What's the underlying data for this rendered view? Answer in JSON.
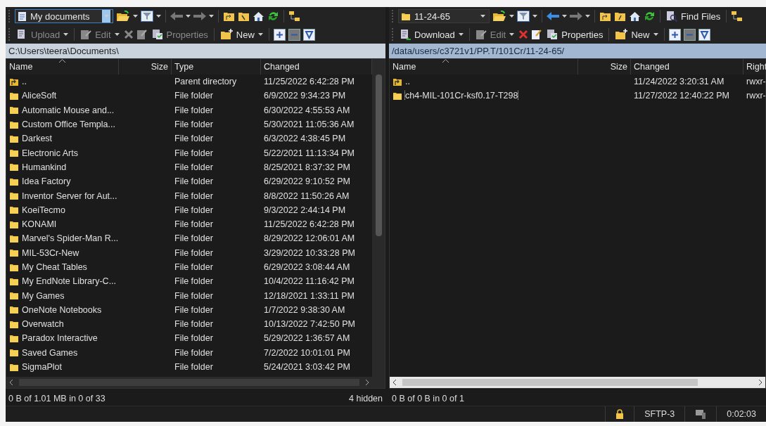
{
  "left_pane": {
    "active": false,
    "location": "My documents",
    "toolbar": [
      {
        "label": "Upload",
        "kind": "upload",
        "disabled": true
      },
      {
        "label": "Edit",
        "kind": "edit",
        "disabled": true
      },
      {
        "label": "Properties",
        "kind": "properties",
        "disabled": true
      },
      {
        "label": "New",
        "kind": "new",
        "disabled": false
      }
    ],
    "path": "C:\\Users\\teera\\Documents\\",
    "columns": [
      "Name",
      "Size",
      "Type",
      "Changed"
    ],
    "rows": [
      {
        "kind": "parent",
        "name": "..",
        "type": "Parent directory",
        "changed": "11/25/2022  6:42:28 PM",
        "focused": false
      },
      {
        "kind": "folder",
        "name": "AliceSoft",
        "type": "File folder",
        "changed": "6/9/2022  9:34:23 PM",
        "focused": false
      },
      {
        "kind": "folder",
        "name": "Automatic Mouse and...",
        "type": "File folder",
        "changed": "6/30/2022  4:55:53 AM",
        "focused": false
      },
      {
        "kind": "folder",
        "name": "Custom Office Templa...",
        "type": "File folder",
        "changed": "5/30/2021  11:05:36 AM",
        "focused": false
      },
      {
        "kind": "folder",
        "name": "Darkest",
        "type": "File folder",
        "changed": "6/3/2022  4:38:45 PM",
        "focused": false
      },
      {
        "kind": "folder",
        "name": "Electronic Arts",
        "type": "File folder",
        "changed": "5/22/2021  11:13:34 PM",
        "focused": false
      },
      {
        "kind": "folder",
        "name": "Humankind",
        "type": "File folder",
        "changed": "8/25/2021  8:37:32 PM",
        "focused": false
      },
      {
        "kind": "folder",
        "name": "Idea Factory",
        "type": "File folder",
        "changed": "6/29/2022  9:10:52 PM",
        "focused": false
      },
      {
        "kind": "folder",
        "name": "Inventor Server for Aut...",
        "type": "File folder",
        "changed": "8/8/2022  11:50:26 AM",
        "focused": false
      },
      {
        "kind": "folder",
        "name": "KoeiTecmo",
        "type": "File folder",
        "changed": "9/3/2022  2:44:14 PM",
        "focused": false
      },
      {
        "kind": "folder",
        "name": "KONAMI",
        "type": "File folder",
        "changed": "11/25/2022  6:42:28 PM",
        "focused": false
      },
      {
        "kind": "folder",
        "name": "Marvel's Spider-Man R...",
        "type": "File folder",
        "changed": "8/29/2022  12:06:01 AM",
        "focused": false
      },
      {
        "kind": "folder",
        "name": "MIL-53Cr-New",
        "type": "File folder",
        "changed": "3/29/2022  10:33:28 PM",
        "focused": false
      },
      {
        "kind": "folder",
        "name": "My Cheat Tables",
        "type": "File folder",
        "changed": "6/29/2022  3:08:44 AM",
        "focused": false
      },
      {
        "kind": "folder",
        "name": "My EndNote Library-C...",
        "type": "File folder",
        "changed": "10/4/2022  11:16:42 PM",
        "focused": false
      },
      {
        "kind": "folder",
        "name": "My Games",
        "type": "File folder",
        "changed": "12/18/2021  1:33:11 PM",
        "focused": false
      },
      {
        "kind": "folder",
        "name": "OneNote Notebooks",
        "type": "File folder",
        "changed": "1/7/2022  9:38:30 AM",
        "focused": false
      },
      {
        "kind": "folder",
        "name": "Overwatch",
        "type": "File folder",
        "changed": "10/13/2022  7:42:50 PM",
        "focused": false
      },
      {
        "kind": "folder",
        "name": "Paradox Interactive",
        "type": "File folder",
        "changed": "5/29/2022  1:36:57 AM",
        "focused": false
      },
      {
        "kind": "folder",
        "name": "Saved Games",
        "type": "File folder",
        "changed": "7/2/2022  10:01:01 PM",
        "focused": false
      },
      {
        "kind": "folder",
        "name": "SigmaPlot",
        "type": "File folder",
        "changed": "5/24/2021  3:03:42 PM",
        "focused": false
      }
    ],
    "status": "0 B of 1.01 MB in 0 of 33",
    "hidden": "4 hidden"
  },
  "right_pane": {
    "active": true,
    "location": "11-24-65",
    "find_files": "Find Files",
    "toolbar": [
      {
        "label": "Download",
        "kind": "download",
        "disabled": false
      },
      {
        "label": "Edit",
        "kind": "edit",
        "disabled": true
      },
      {
        "label": "Properties",
        "kind": "properties",
        "disabled": false
      },
      {
        "label": "New",
        "kind": "new",
        "disabled": false
      }
    ],
    "path": "/data/users/c3721v1/PP.T/101Cr/11-24-65/",
    "columns": [
      "Name",
      "Size",
      "Changed",
      "Right"
    ],
    "rows": [
      {
        "kind": "parent",
        "name": "..",
        "changed": "11/24/2022  3:20:31 AM",
        "rights": "rwxr-",
        "focused": false
      },
      {
        "kind": "folder",
        "name": "ch4-MIL-101Cr-ksf0.17-T298",
        "changed": "11/27/2022  12:40:22 PM",
        "rights": "rwxr-",
        "focused": true
      }
    ],
    "status": "0 B of 0 B in 0 of 1"
  },
  "status_bar": {
    "protocol": "SFTP-3",
    "time": "0:02:03"
  }
}
